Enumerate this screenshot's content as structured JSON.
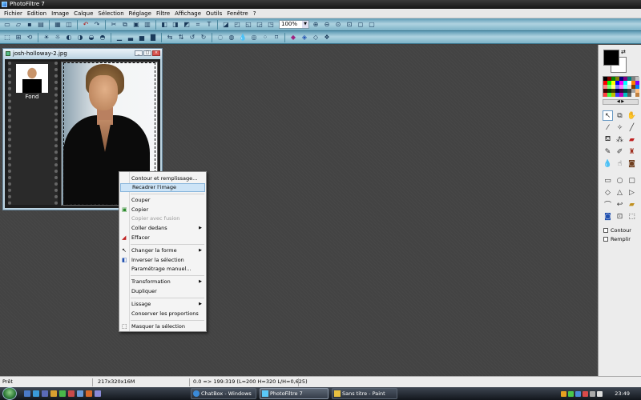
{
  "window": {
    "title": "PhotoFiltre 7"
  },
  "menu": [
    "Fichier",
    "Edition",
    "Image",
    "Calque",
    "Sélection",
    "Réglage",
    "Filtre",
    "Affichage",
    "Outils",
    "Fenêtre",
    "?"
  ],
  "toolbar": {
    "zoom": "100%"
  },
  "document": {
    "title": "josh-holloway-2.jpg",
    "layer_name": "Fond"
  },
  "context_menu": {
    "items": [
      {
        "label": "Contour et remplissage...",
        "state": "normal",
        "icon": "",
        "submenu": false
      },
      {
        "label": "Recadrer l'image",
        "state": "highlighted",
        "icon": "",
        "submenu": false
      },
      {
        "label": "Couper",
        "state": "normal",
        "icon": "",
        "submenu": false
      },
      {
        "label": "Copier",
        "state": "normal",
        "icon": "copy-icon",
        "submenu": false
      },
      {
        "label": "Copier avec fusion",
        "state": "disabled",
        "icon": "",
        "submenu": false
      },
      {
        "label": "Coller dedans",
        "state": "normal",
        "icon": "",
        "submenu": true
      },
      {
        "label": "Effacer",
        "state": "normal",
        "icon": "eraser-icon",
        "submenu": false
      },
      {
        "label": "Changer la forme",
        "state": "normal",
        "icon": "pointer-icon",
        "submenu": true
      },
      {
        "label": "Inverser la sélection",
        "state": "normal",
        "icon": "invert-icon",
        "submenu": false
      },
      {
        "label": "Paramétrage manuel...",
        "state": "normal",
        "icon": "",
        "submenu": false
      },
      {
        "label": "Transformation",
        "state": "normal",
        "icon": "",
        "submenu": true
      },
      {
        "label": "Dupliquer",
        "state": "normal",
        "icon": "",
        "submenu": false
      },
      {
        "label": "Lissage",
        "state": "normal",
        "icon": "",
        "submenu": true
      },
      {
        "label": "Conserver les proportions",
        "state": "normal",
        "icon": "",
        "submenu": false
      },
      {
        "label": "Masquer la sélection",
        "state": "normal",
        "icon": "hide-selection-icon",
        "submenu": false
      }
    ]
  },
  "right_panel": {
    "foreground_color": "#000000",
    "background_color": "#ffffff",
    "contour_label": "Contour",
    "remplir_label": "Remplir",
    "palette": [
      "#000000",
      "#800000",
      "#008000",
      "#808000",
      "#000080",
      "#800080",
      "#008080",
      "#808080",
      "#c0c0c0",
      "#ff0000",
      "#00ff00",
      "#ffff00",
      "#0000ff",
      "#ff00ff",
      "#00ffff",
      "#ffffff",
      "#ff8000",
      "#8000ff",
      "#ff8080",
      "#80ff80",
      "#ffff80",
      "#8080ff",
      "#ff80ff",
      "#80ffff",
      "#e0e0e0",
      "#804000",
      "#0080ff",
      "#400000",
      "#004000",
      "#404000",
      "#000040",
      "#400040",
      "#004040",
      "#404040",
      "#a0a0a0",
      "#ffc080",
      "#ff4040",
      "#40ff40",
      "#c0c000",
      "#4040ff",
      "#c000c0",
      "#00c0c0",
      "#606060",
      "#f0f0f0",
      "#c08040"
    ]
  },
  "status": {
    "ready": "Prêt",
    "size": "217x320x16M",
    "selection": "0.0 => 199:319 (L=200  H=320  L/H=0,625)"
  },
  "taskbar": {
    "tasks": [
      {
        "label": "ChatBox - Windows ...",
        "active": false
      },
      {
        "label": "PhotoFiltre 7",
        "active": true
      },
      {
        "label": "Sans titre - Paint",
        "active": false
      }
    ],
    "clock": "23:49"
  }
}
